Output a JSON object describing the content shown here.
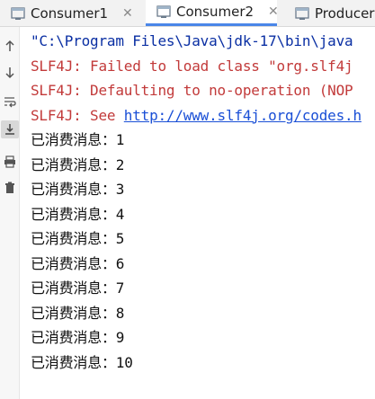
{
  "tabs": [
    {
      "label": "Consumer1",
      "active": false,
      "close": "✕"
    },
    {
      "label": "Consumer2",
      "active": true,
      "close": "✕"
    },
    {
      "label": "Producer",
      "active": false,
      "close": ""
    }
  ],
  "toolbar": [
    {
      "icon": "arrow-up-icon"
    },
    {
      "icon": "arrow-down-icon"
    },
    {
      "icon": "soft-wrap-icon"
    },
    {
      "icon": "scroll-to-end-icon",
      "selected": true
    },
    {
      "icon": "print-icon"
    },
    {
      "icon": "trash-icon"
    }
  ],
  "console": {
    "command": "\"C:\\Program Files\\Java\\jdk-17\\bin\\java",
    "errors": [
      "SLF4J: Failed to load class \"org.slf4j",
      "SLF4J: Defaulting to no-operation (NOP"
    ],
    "see_prefix": "SLF4J: See ",
    "see_link": "http://www.slf4j.org/codes.h",
    "messages": [
      "已消费消息：1",
      "已消费消息：2",
      "已消费消息：3",
      "已消费消息：4",
      "已消费消息：5",
      "已消费消息：6",
      "已消费消息：7",
      "已消费消息：8",
      "已消费消息：9",
      "已消费消息：10"
    ]
  },
  "colors": {
    "command": "#0a2fa3",
    "error": "#c23a3a",
    "link": "#1a4fd6",
    "active_tab_underline": "#4a86e8"
  }
}
